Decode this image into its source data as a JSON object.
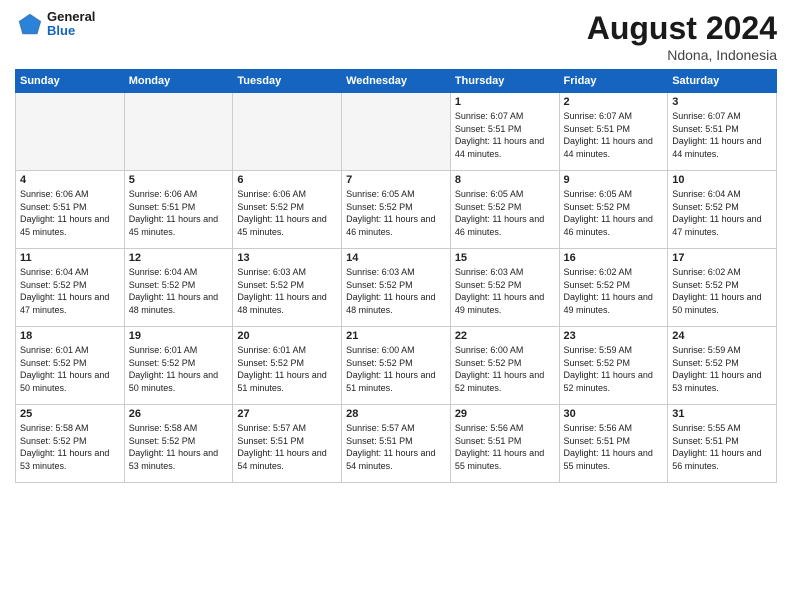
{
  "header": {
    "logo_line1": "General",
    "logo_line2": "Blue",
    "month_year": "August 2024",
    "location": "Ndona, Indonesia"
  },
  "days_of_week": [
    "Sunday",
    "Monday",
    "Tuesday",
    "Wednesday",
    "Thursday",
    "Friday",
    "Saturday"
  ],
  "weeks": [
    [
      {
        "day": "",
        "empty": true
      },
      {
        "day": "",
        "empty": true
      },
      {
        "day": "",
        "empty": true
      },
      {
        "day": "",
        "empty": true
      },
      {
        "day": "1",
        "sunrise": "6:07 AM",
        "sunset": "5:51 PM",
        "daylight": "11 hours and 44 minutes."
      },
      {
        "day": "2",
        "sunrise": "6:07 AM",
        "sunset": "5:51 PM",
        "daylight": "11 hours and 44 minutes."
      },
      {
        "day": "3",
        "sunrise": "6:07 AM",
        "sunset": "5:51 PM",
        "daylight": "11 hours and 44 minutes."
      }
    ],
    [
      {
        "day": "4",
        "sunrise": "6:06 AM",
        "sunset": "5:51 PM",
        "daylight": "11 hours and 45 minutes."
      },
      {
        "day": "5",
        "sunrise": "6:06 AM",
        "sunset": "5:51 PM",
        "daylight": "11 hours and 45 minutes."
      },
      {
        "day": "6",
        "sunrise": "6:06 AM",
        "sunset": "5:52 PM",
        "daylight": "11 hours and 45 minutes."
      },
      {
        "day": "7",
        "sunrise": "6:05 AM",
        "sunset": "5:52 PM",
        "daylight": "11 hours and 46 minutes."
      },
      {
        "day": "8",
        "sunrise": "6:05 AM",
        "sunset": "5:52 PM",
        "daylight": "11 hours and 46 minutes."
      },
      {
        "day": "9",
        "sunrise": "6:05 AM",
        "sunset": "5:52 PM",
        "daylight": "11 hours and 46 minutes."
      },
      {
        "day": "10",
        "sunrise": "6:04 AM",
        "sunset": "5:52 PM",
        "daylight": "11 hours and 47 minutes."
      }
    ],
    [
      {
        "day": "11",
        "sunrise": "6:04 AM",
        "sunset": "5:52 PM",
        "daylight": "11 hours and 47 minutes."
      },
      {
        "day": "12",
        "sunrise": "6:04 AM",
        "sunset": "5:52 PM",
        "daylight": "11 hours and 48 minutes."
      },
      {
        "day": "13",
        "sunrise": "6:03 AM",
        "sunset": "5:52 PM",
        "daylight": "11 hours and 48 minutes."
      },
      {
        "day": "14",
        "sunrise": "6:03 AM",
        "sunset": "5:52 PM",
        "daylight": "11 hours and 48 minutes."
      },
      {
        "day": "15",
        "sunrise": "6:03 AM",
        "sunset": "5:52 PM",
        "daylight": "11 hours and 49 minutes."
      },
      {
        "day": "16",
        "sunrise": "6:02 AM",
        "sunset": "5:52 PM",
        "daylight": "11 hours and 49 minutes."
      },
      {
        "day": "17",
        "sunrise": "6:02 AM",
        "sunset": "5:52 PM",
        "daylight": "11 hours and 50 minutes."
      }
    ],
    [
      {
        "day": "18",
        "sunrise": "6:01 AM",
        "sunset": "5:52 PM",
        "daylight": "11 hours and 50 minutes."
      },
      {
        "day": "19",
        "sunrise": "6:01 AM",
        "sunset": "5:52 PM",
        "daylight": "11 hours and 50 minutes."
      },
      {
        "day": "20",
        "sunrise": "6:01 AM",
        "sunset": "5:52 PM",
        "daylight": "11 hours and 51 minutes."
      },
      {
        "day": "21",
        "sunrise": "6:00 AM",
        "sunset": "5:52 PM",
        "daylight": "11 hours and 51 minutes."
      },
      {
        "day": "22",
        "sunrise": "6:00 AM",
        "sunset": "5:52 PM",
        "daylight": "11 hours and 52 minutes."
      },
      {
        "day": "23",
        "sunrise": "5:59 AM",
        "sunset": "5:52 PM",
        "daylight": "11 hours and 52 minutes."
      },
      {
        "day": "24",
        "sunrise": "5:59 AM",
        "sunset": "5:52 PM",
        "daylight": "11 hours and 53 minutes."
      }
    ],
    [
      {
        "day": "25",
        "sunrise": "5:58 AM",
        "sunset": "5:52 PM",
        "daylight": "11 hours and 53 minutes."
      },
      {
        "day": "26",
        "sunrise": "5:58 AM",
        "sunset": "5:52 PM",
        "daylight": "11 hours and 53 minutes."
      },
      {
        "day": "27",
        "sunrise": "5:57 AM",
        "sunset": "5:51 PM",
        "daylight": "11 hours and 54 minutes."
      },
      {
        "day": "28",
        "sunrise": "5:57 AM",
        "sunset": "5:51 PM",
        "daylight": "11 hours and 54 minutes."
      },
      {
        "day": "29",
        "sunrise": "5:56 AM",
        "sunset": "5:51 PM",
        "daylight": "11 hours and 55 minutes."
      },
      {
        "day": "30",
        "sunrise": "5:56 AM",
        "sunset": "5:51 PM",
        "daylight": "11 hours and 55 minutes."
      },
      {
        "day": "31",
        "sunrise": "5:55 AM",
        "sunset": "5:51 PM",
        "daylight": "11 hours and 56 minutes."
      }
    ]
  ]
}
